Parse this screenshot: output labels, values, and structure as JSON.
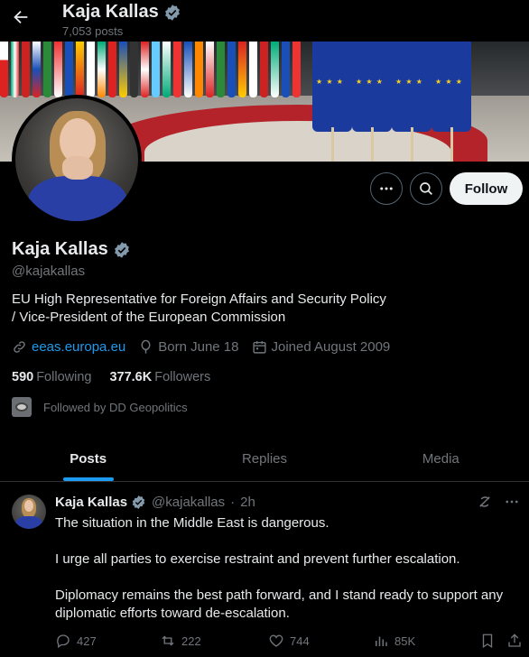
{
  "header": {
    "name": "Kaja Kallas",
    "post_count": "7,053 posts"
  },
  "profile": {
    "name": "Kaja Kallas",
    "handle": "@kajakallas",
    "bio_line1": "EU High Representative for Foreign Affairs and Security Policy",
    "bio_line2": "/ Vice-President of the European Commission",
    "website": "eeas.europa.eu",
    "born": "Born June 18",
    "joined": "Joined August 2009",
    "following_count": "590",
    "following_label": "Following",
    "followers_count": "377.6K",
    "followers_label": "Followers",
    "followed_by": "Followed by DD Geopolitics",
    "follow_button": "Follow"
  },
  "tabs": [
    {
      "label": "Posts",
      "active": true
    },
    {
      "label": "Replies",
      "active": false
    },
    {
      "label": "Media",
      "active": false
    }
  ],
  "tweet": {
    "name": "Kaja Kallas",
    "handle": "@kajakallas",
    "separator": "·",
    "time": "2h",
    "paragraphs": [
      "The situation in the Middle East is dangerous.",
      "I urge all parties to exercise restraint and prevent further escalation.",
      "Diplomacy remains the best path forward, and I stand ready to support any diplomatic efforts toward de-escalation."
    ],
    "replies": "427",
    "reposts": "222",
    "likes": "744",
    "views": "85K"
  },
  "colors": {
    "accent": "#1d9bf0",
    "background": "#000000",
    "muted": "#71767b",
    "verified_badge": "#829aab"
  },
  "icons": {
    "back": "arrow-left-icon",
    "verified": "verified-badge-icon",
    "more": "more-icon",
    "search": "search-icon",
    "link": "link-icon",
    "born": "balloon-icon",
    "joined": "calendar-icon",
    "grok": "grok-icon",
    "reply": "reply-icon",
    "repost": "repost-icon",
    "like": "heart-icon",
    "views": "views-icon",
    "bookmark": "bookmark-icon",
    "share": "share-icon"
  }
}
